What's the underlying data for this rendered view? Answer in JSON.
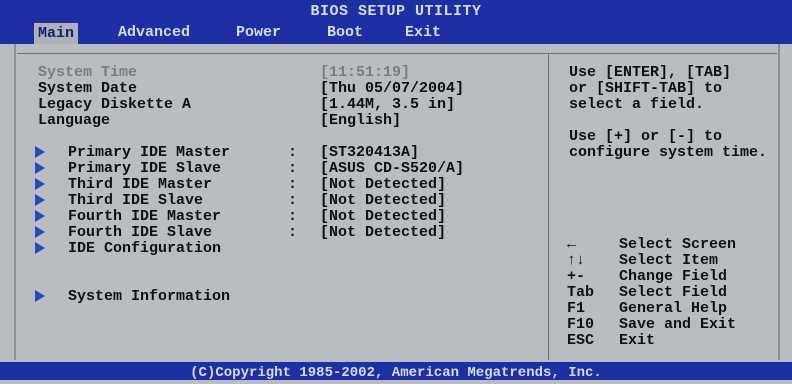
{
  "header": {
    "title": "BIOS SETUP UTILITY",
    "tabs": [
      "Main",
      "Advanced",
      "Power",
      "Boot",
      "Exit"
    ],
    "active_tab": "Main"
  },
  "main": {
    "system_time": {
      "label": "System Time",
      "value": "[11:51:19]"
    },
    "system_date": {
      "label": "System Date",
      "value": "[Thu 05/07/2004]"
    },
    "legacy_diskette": {
      "label": "Legacy Diskette A",
      "value": "[1.44M, 3.5 in]"
    },
    "language": {
      "label": "Language",
      "value": "[English]"
    },
    "ide_devices": [
      {
        "label": "Primary IDE Master",
        "value": "[ST320413A]"
      },
      {
        "label": "Primary IDE Slave",
        "value": "[ASUS CD-S520/A]"
      },
      {
        "label": "Third IDE Master",
        "value": "[Not Detected]"
      },
      {
        "label": "Third IDE Slave",
        "value": "[Not Detected]"
      },
      {
        "label": "Fourth IDE Master",
        "value": "[Not Detected]"
      },
      {
        "label": "Fourth IDE Slave",
        "value": "[Not Detected]"
      }
    ],
    "ide_configuration": "IDE Configuration",
    "system_information": "System Information",
    "colon": ":"
  },
  "help": {
    "line1": "Use [ENTER], [TAB]",
    "line2": "or [SHIFT-TAB] to",
    "line3": "select a field.",
    "line4": "Use [+] or [-] to",
    "line5": "configure system time."
  },
  "keys": [
    {
      "key": "←",
      "desc": "Select Screen"
    },
    {
      "key": "↑↓",
      "desc": "Select Item"
    },
    {
      "key": "+-",
      "desc": "Change Field"
    },
    {
      "key": "Tab",
      "desc": "Select Field"
    },
    {
      "key": "F1",
      "desc": "General Help"
    },
    {
      "key": "F10",
      "desc": "Save and Exit"
    },
    {
      "key": "ESC",
      "desc": "Exit"
    }
  ],
  "footer": "(C)Copyright 1985-2002, American Megatrends, Inc.",
  "colors": {
    "blue": "#1d2fa3",
    "panel": "#b9bcc0",
    "arrow": "#2747b8"
  }
}
